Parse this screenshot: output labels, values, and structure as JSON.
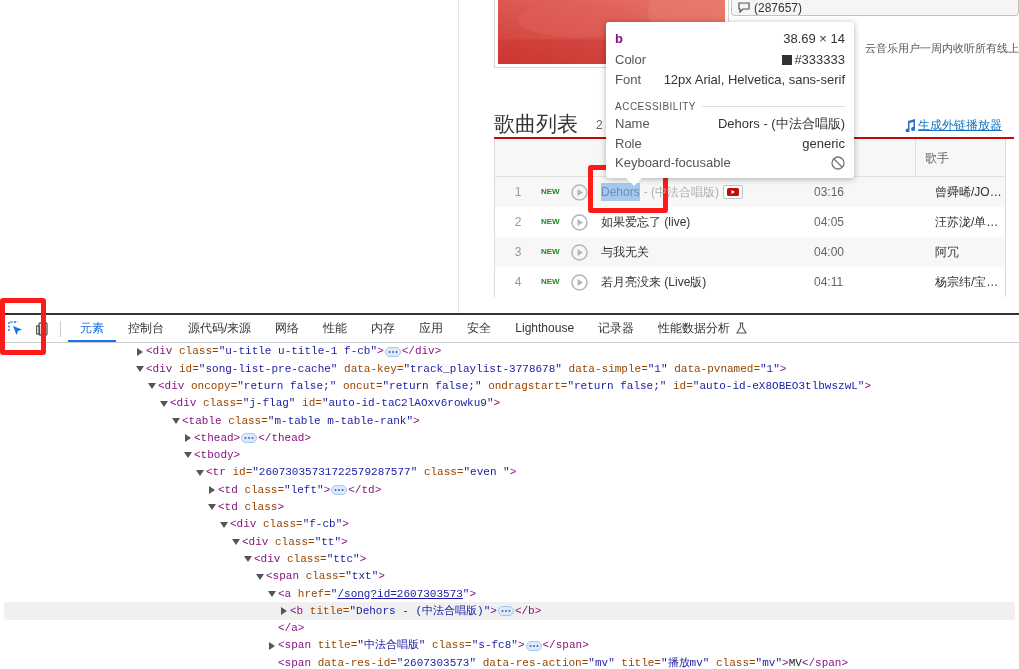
{
  "page": {
    "comment_button": "(287657)",
    "description": "云音乐用户一周内收听所有线上",
    "song_list": {
      "title": "歌曲列表",
      "count": "2",
      "link": "生成外链播放器",
      "columns": [
        "歌手"
      ],
      "rows": [
        {
          "number": "1",
          "badge": "NEW",
          "title": "Dehors",
          "subtitle": "- (中法合唱版)",
          "mv": true,
          "duration": "03:16",
          "artist": "曾舜晞/JO…",
          "highlighted": true
        },
        {
          "number": "2",
          "badge": "NEW",
          "title": "如果爱忘了 (live)",
          "mv": false,
          "duration": "04:05",
          "artist": "汪苏泷/单…",
          "highlighted": false
        },
        {
          "number": "3",
          "badge": "NEW",
          "title": "与我无关",
          "mv": false,
          "duration": "04:00",
          "artist": "阿冗",
          "highlighted": false
        },
        {
          "number": "4",
          "badge": "NEW",
          "title": "若月亮没来 (Live版)",
          "mv": false,
          "duration": "04:11",
          "artist": "杨宗纬/宝…",
          "highlighted": false
        }
      ]
    }
  },
  "inspect_tooltip": {
    "tag": "b",
    "size": "38.69 × 14",
    "style": [
      {
        "label": "Color",
        "value": "#333333",
        "color": "#333333"
      },
      {
        "label": "Font",
        "value": "12px Arial, Helvetica, sans-serif"
      }
    ],
    "section": "ACCESSIBILITY",
    "accessibility": [
      {
        "label": "Name",
        "value": "Dehors - (中法合唱版)"
      },
      {
        "label": "Role",
        "value": "generic"
      },
      {
        "label": "Keyboard-focusable",
        "focusable": false
      }
    ]
  },
  "devtools": {
    "inspect_active": true,
    "device_active": false,
    "tabs": [
      {
        "label": "元素",
        "selected": true
      },
      {
        "label": "控制台",
        "selected": false
      },
      {
        "label": "源代码/来源",
        "selected": false
      },
      {
        "label": "网络",
        "selected": false
      },
      {
        "label": "性能",
        "selected": false
      },
      {
        "label": "内存",
        "selected": false
      },
      {
        "label": "应用",
        "selected": false
      },
      {
        "label": "安全",
        "selected": false
      },
      {
        "label": "Lighthouse",
        "selected": false
      },
      {
        "label": "记录器",
        "selected": false
      },
      {
        "label": "性能数据分析",
        "selected": false,
        "experimental": true
      }
    ],
    "elements_tree": [
      {
        "kind": "element",
        "tag": "<div class=\"u-title u-title-1 f-cb\">",
        "close": "</div>",
        "expanded": false,
        "selected": false
      },
      {
        "kind": "element",
        "tag": "<div id=\"song-list-pre-cache\" data-key=\"track_playlist-3778678\" data-simple=\"1\" data-pvnamed=\"1\">",
        "expanded": true,
        "selected": false,
        "children": [
          {
            "kind": "element",
            "tag": "<div oncopy=\"return false;\" oncut=\"return false;\" ondragstart=\"return false;\" id=\"auto-id-eX8OBEO3tlbwszwL\">",
            "expanded": true,
            "selected": false,
            "children": [
              {
                "kind": "element",
                "tag": "<div class=\"j-flag\" id=\"auto-id-taC2lAOxv6rowku9\">",
                "expanded": true,
                "selected": false,
                "children": [
                  {
                    "kind": "element",
                    "tag": "<table class=\"m-table m-table-rank\">",
                    "expanded": true,
                    "selected": false,
                    "children": [
                      {
                        "kind": "element",
                        "tag": "<thead>",
                        "close": "</thead>",
                        "expanded": false,
                        "selected": false
                      },
                      {
                        "kind": "element",
                        "tag": "<tbody>",
                        "expanded": true,
                        "selected": false,
                        "children": [
                          {
                            "kind": "element",
                            "tag": "<tr id=\"26073035731722579287577\" class=\"even \">",
                            "expanded": true,
                            "selected": false,
                            "children": [
                              {
                                "kind": "element",
                                "tag": "<td class=\"left\">",
                                "close": "</td>",
                                "expanded": false,
                                "selected": false
                              },
                              {
                                "kind": "element",
                                "tag": "<td class>",
                                "expanded": true,
                                "selected": false,
                                "children": [
                                  {
                                    "kind": "element",
                                    "tag": "<div class=\"f-cb\">",
                                    "expanded": true,
                                    "selected": false,
                                    "children": [
                                      {
                                        "kind": "element",
                                        "tag": "<div class=\"tt\">",
                                        "expanded": true,
                                        "selected": false,
                                        "children": [
                                          {
                                            "kind": "element",
                                            "tag": "<div class=\"ttc\">",
                                            "expanded": true,
                                            "selected": false,
                                            "children": [
                                              {
                                                "kind": "element",
                                                "tag": "<span class=\"txt\">",
                                                "expanded": true,
                                                "selected": false,
                                                "children": [
                                                  {
                                                    "kind": "link_element",
                                                    "tag": "<a href=\"",
                                                    "href": "/song?id=2607303573",
                                                    "tag_end": "\">",
                                                    "end": "</a>",
                                                    "expanded": true,
                                                    "selected": false,
                                                    "children": [
                                                      {
                                                        "kind": "element",
                                                        "tag": "<b title=\"Dehors - (中法合唱版)\">",
                                                        "close": "</b>",
                                                        "expanded": false,
                                                        "selected": true
                                                      }
                                                    ]
                                                  },
                                                  {
                                                    "kind": "element",
                                                    "tag": "<span title=\"中法合唱版\" class=\"s-fc8\">",
                                                    "close": "</span>",
                                                    "expanded": false,
                                                    "selected": false
                                                  },
                                                  {
                                                    "kind": "leaf",
                                                    "tag": "<span data-res-id=\"2607303573\" data-res-action=\"mv\" title=\"播放mv\" class=\"mv\">",
                                                    "text": "MV",
                                                    "close": "</span>",
                                                    "selected": false
                                                  }
                                                ]
                                              }
                                            ]
                                          }
                                        ]
                                      }
                                    ]
                                  }
                                ]
                              }
                            ]
                          }
                        ]
                      }
                    ]
                  }
                ]
              }
            ]
          }
        ]
      }
    ]
  }
}
